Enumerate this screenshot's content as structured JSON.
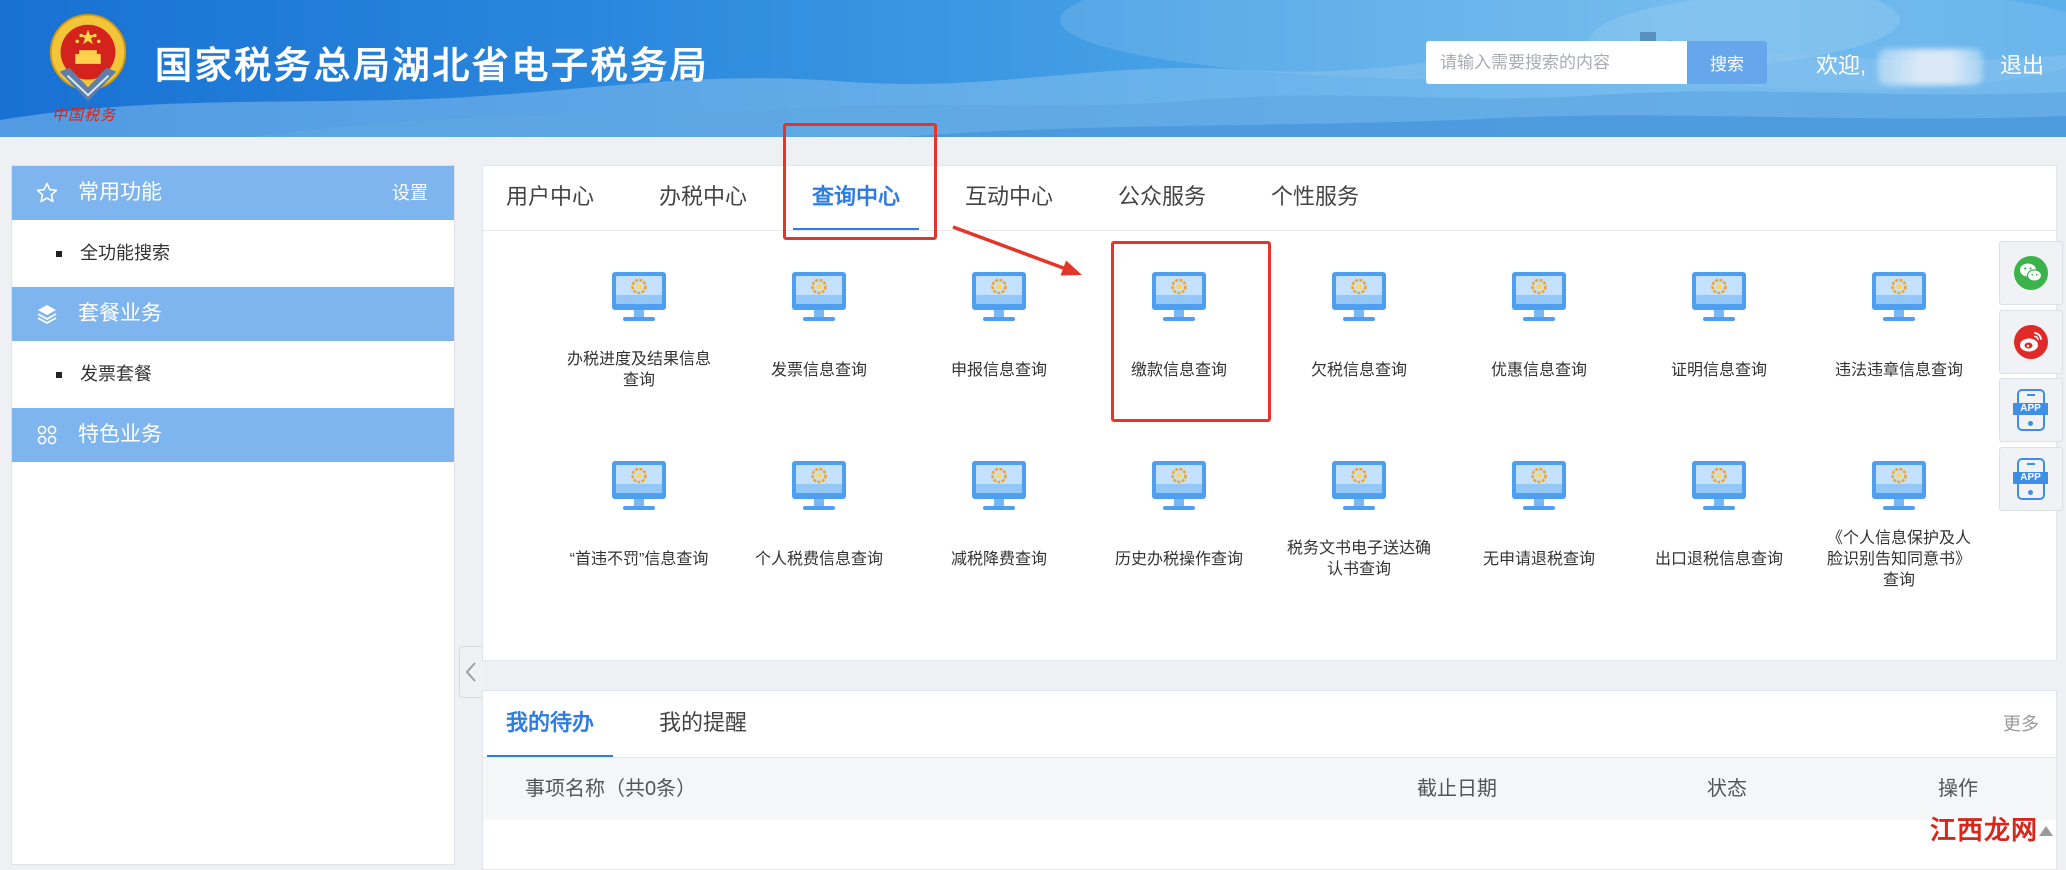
{
  "header": {
    "title": "国家税务总局湖北省电子税务局",
    "logo_icon": "national-emblem-icon",
    "logo_text": "中国税务",
    "search_icon": "none",
    "search_placeholder": "请输入需要搜索的内容",
    "search_button": "搜索",
    "welcome": "欢迎,",
    "logout": "退出"
  },
  "sidebar": {
    "sections": [
      {
        "title": "常用功能",
        "icon": "star-icon",
        "action": "设置",
        "items": [
          "全功能搜索"
        ]
      },
      {
        "title": "套餐业务",
        "icon": "layers-icon",
        "items": [
          "发票套餐"
        ]
      },
      {
        "title": "特色业务",
        "icon": "grid-icon",
        "items": []
      }
    ],
    "collapse_icon": "chevron-left-icon"
  },
  "main_tabs": [
    "用户中心",
    "办税中心",
    "查询中心",
    "互动中心",
    "公众服务",
    "个性服务"
  ],
  "active_tab_index": 2,
  "tile_icon": "monitor-icon",
  "query_items": [
    "办税进度及结果信息查询",
    "发票信息查询",
    "申报信息查询",
    "缴款信息查询",
    "欠税信息查询",
    "优惠信息查询",
    "证明信息查询",
    "违法违章信息查询",
    "“首违不罚”信息查询",
    "个人税费信息查询",
    "减税降费查询",
    "历史办税操作查询",
    "税务文书电子送达确认书查询",
    "无申请退税查询",
    "出口退税信息查询",
    "《个人信息保护及人脸识别告知同意书》查询"
  ],
  "todo": {
    "tabs": [
      "我的待办",
      "我的提醒"
    ],
    "active_tab_index": 0,
    "more": "更多",
    "columns": [
      "事项名称（共0条）",
      "截止日期",
      "状态",
      "操作"
    ]
  },
  "float_tools": [
    {
      "icon": "wechat-icon"
    },
    {
      "icon": "weibo-icon"
    },
    {
      "icon": "app-icon",
      "label": "APP"
    },
    {
      "icon": "app-icon",
      "label": "APP"
    }
  ],
  "watermark": "江西龙网",
  "colors": {
    "header_blue": "#1871d3",
    "accent": "#2f7de1",
    "sidebar_band": "#7fb5ef",
    "search_button": "#66a7ec",
    "highlight_red": "#e5352b",
    "wechat_green": "#3cb34a",
    "weibo_red": "#e02a2a",
    "app_blue": "#3d8fe6",
    "page_bg": "#eef0f4"
  }
}
